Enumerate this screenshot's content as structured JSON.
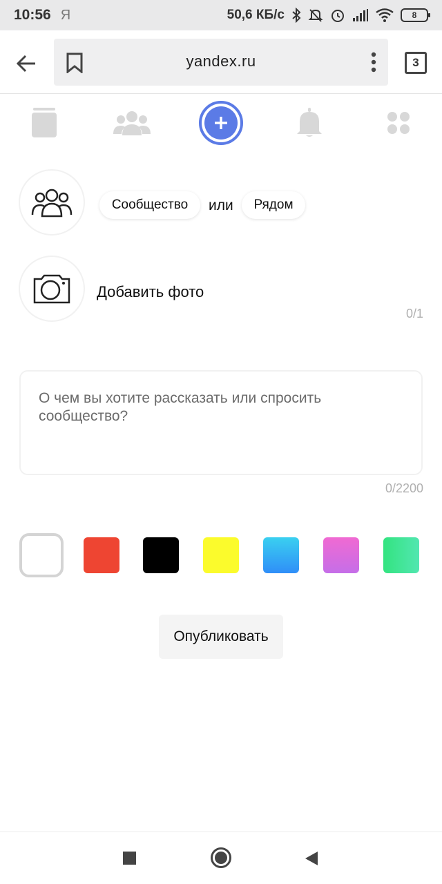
{
  "status_bar": {
    "time": "10:56",
    "app_glyph": "Я",
    "speed": "50,6 КБ/с",
    "battery": "8",
    "icons": [
      "bluetooth-icon",
      "mute-icon",
      "alarm-icon",
      "signal-icon",
      "wifi-icon",
      "battery-icon"
    ]
  },
  "browser": {
    "url": "yandex.ru",
    "tabs_count": "3",
    "icons": [
      "back-arrow-icon",
      "bookmark-icon",
      "menu-dots-icon"
    ]
  },
  "nav_icons": [
    "feed-icon",
    "communities-icon",
    "add-post-icon",
    "bell-icon",
    "services-icon"
  ],
  "accent_color": "#5b7be6",
  "form": {
    "community_chip": "Сообщество",
    "or_text": "или",
    "nearby_chip": "Рядом",
    "add_photo": "Добавить фото",
    "photo_counter": "0/1",
    "text_placeholder": "О чем вы хотите рассказать или спросить сообщество?",
    "text_counter": "0/2200",
    "publish": "Опубликовать"
  },
  "colors": [
    {
      "name": "white",
      "color": "#ffffff",
      "selected": true
    },
    {
      "name": "red",
      "color": "#ee4532"
    },
    {
      "name": "black",
      "color": "#000000"
    },
    {
      "name": "yellow",
      "color": "#fbfb2c"
    },
    {
      "name": "blue",
      "color": "#2fb3f5"
    },
    {
      "name": "purple",
      "color": "#e06ad8"
    },
    {
      "name": "green",
      "color": "#37e58e"
    }
  ],
  "system_nav": [
    "recents-icon",
    "home-icon",
    "back-icon"
  ]
}
